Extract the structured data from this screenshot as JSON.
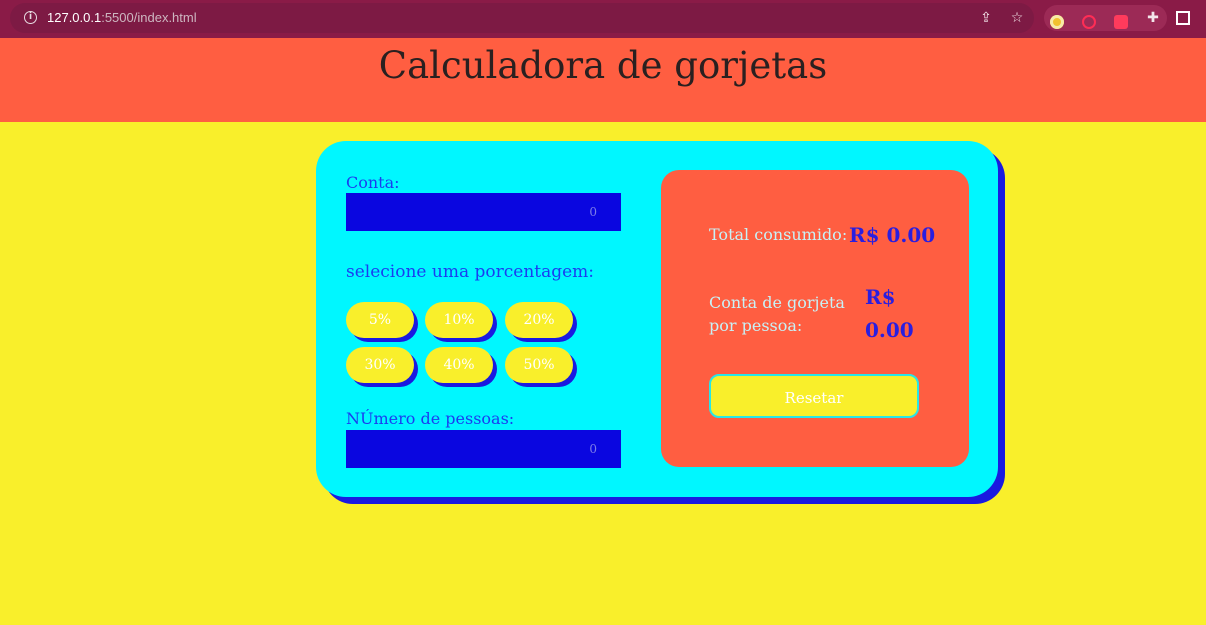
{
  "browser": {
    "url_host": "127.0.0.1",
    "url_rest": ":5500/index.html",
    "icons": [
      "info-icon",
      "share-icon",
      "star-icon",
      "extension-icon",
      "sidebar-icon"
    ]
  },
  "page": {
    "title": "Calculadora de gorjetas"
  },
  "form": {
    "bill_label": "Conta:",
    "bill_placeholder": "0",
    "tip_label": "selecione uma porcentagem:",
    "tips": [
      "5%",
      "10%",
      "20%",
      "30%",
      "40%",
      "50%"
    ],
    "people_label": "NÚmero de pessoas:",
    "people_placeholder": "0"
  },
  "results": {
    "total_label": "Total consumido:",
    "total_value": "R$ 0.00",
    "per_person_label": "Conta de gorjeta por pessoa:",
    "per_person_currency": "R$",
    "per_person_amount": "0.00",
    "reset_label": "Resetar"
  },
  "colors": {
    "background": "#f9ef2b",
    "header": "#ff5e41",
    "card": "#00f7ff",
    "input": "#0a06e0",
    "accent_blue": "#1a1ae0"
  }
}
